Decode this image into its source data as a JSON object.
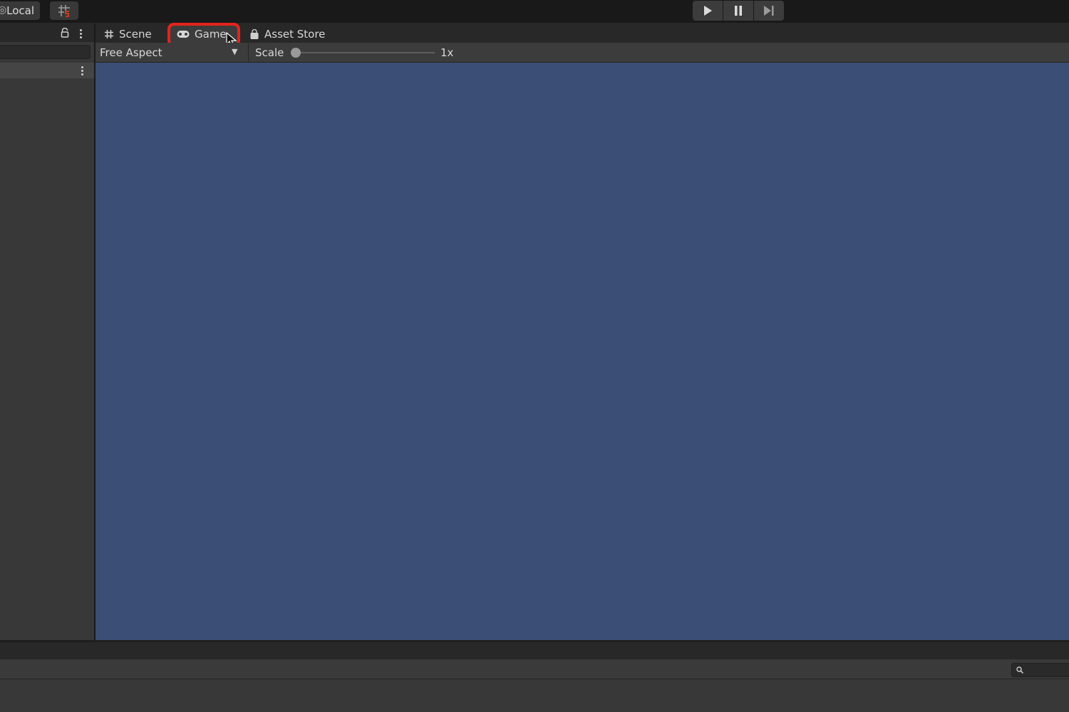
{
  "toolbar": {
    "pivot_mode_label": "Local",
    "grid_snap_icon": "grid-snap-icon",
    "play_icon": "play-icon",
    "pause_icon": "pause-icon",
    "step_icon": "step-icon"
  },
  "tabs": [
    {
      "label": "Scene",
      "icon": "scene-grid-icon"
    },
    {
      "label": "Game",
      "icon": "gamepad-icon",
      "active": true
    },
    {
      "label": "Asset Store",
      "icon": "shopping-bag-icon"
    }
  ],
  "game_toolbar": {
    "aspect_label": "Free Aspect",
    "scale_label": "Scale",
    "scale_value": "1x",
    "scale_level": 0.0
  },
  "colors": {
    "game_view_background": "#3a4e76",
    "highlight": "#e4241d",
    "editor_dark": "#282828"
  }
}
